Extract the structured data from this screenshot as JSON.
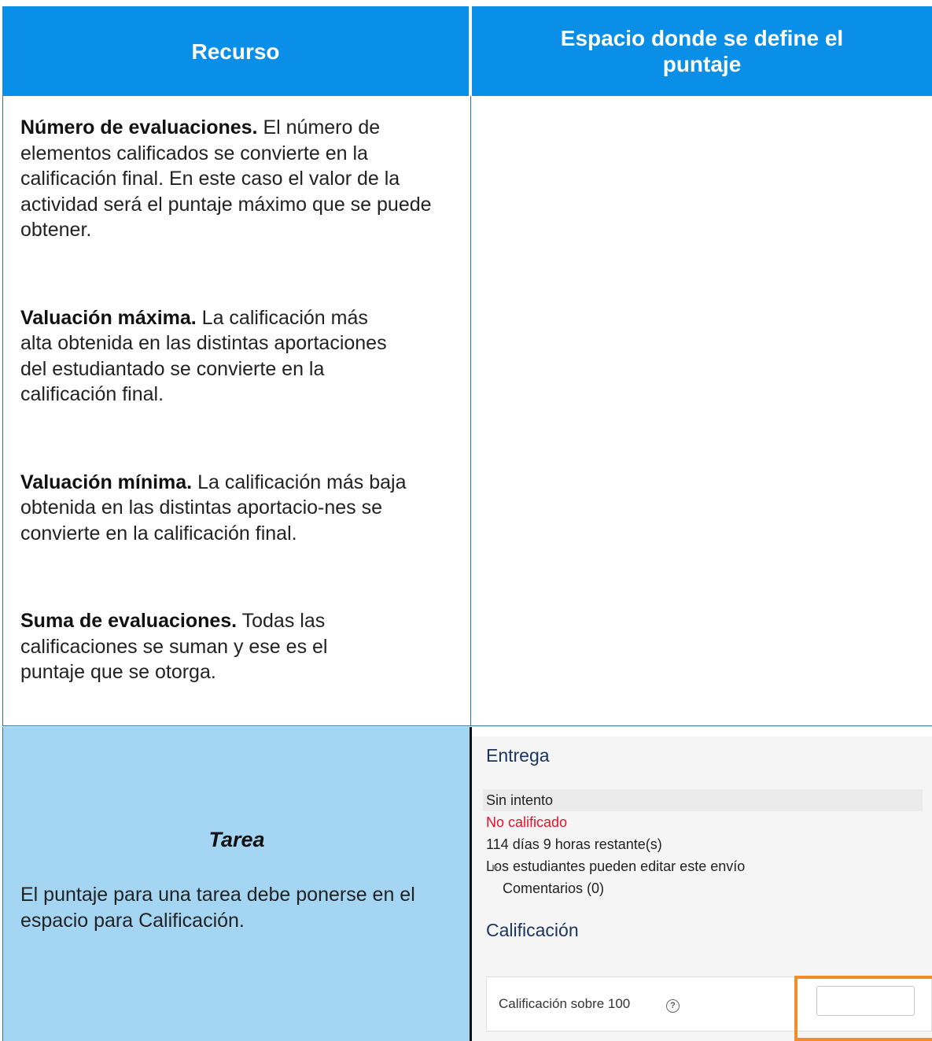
{
  "header": {
    "col1": "Recurso",
    "col2": "Espacio donde se define el puntaje"
  },
  "row1": {
    "items": [
      {
        "title": "Número de evaluaciones.",
        "text": "El número de elementos calificados se convierte en la calificación final. En este caso el valor de la actividad será el puntaje máximo que se puede obtener."
      },
      {
        "title": "Valuación máxima.",
        "text": "La calificación más alta obtenida en las distintas aportaciones del estudiantado se convierte en la calificación final."
      },
      {
        "title": "Valuación mínima.",
        "text": "La calificación más baja obtenida en las distintas aportacio-nes se convierte en la calificación final."
      },
      {
        "title": "Suma de evaluaciones.",
        "text": "Todas las calificaciones se suman y ese es el puntaje que se otorga."
      }
    ]
  },
  "row2": {
    "title": "Tarea",
    "text": "El puntaje para una tarea debe ponerse en el espacio para Calificación.",
    "screenshot": {
      "section1": "Entrega",
      "status": "Sin intento",
      "grade_status": "No calificado",
      "time_left": "114 días 9 horas restante(s)",
      "edit_note": "Los estudiantes pueden editar este envío",
      "comments": "Comentarios (0)",
      "section2": "Calificación",
      "grade_label": "Calificación sobre 100",
      "help_icon": "?",
      "grade_value": "",
      "highlight_color": "#f28c28",
      "error_color": "#e8102a"
    }
  },
  "colors": {
    "header_bg": "#0a8fe8",
    "tarea_bg": "#a4d6f4",
    "border": "#2c6fb0"
  }
}
